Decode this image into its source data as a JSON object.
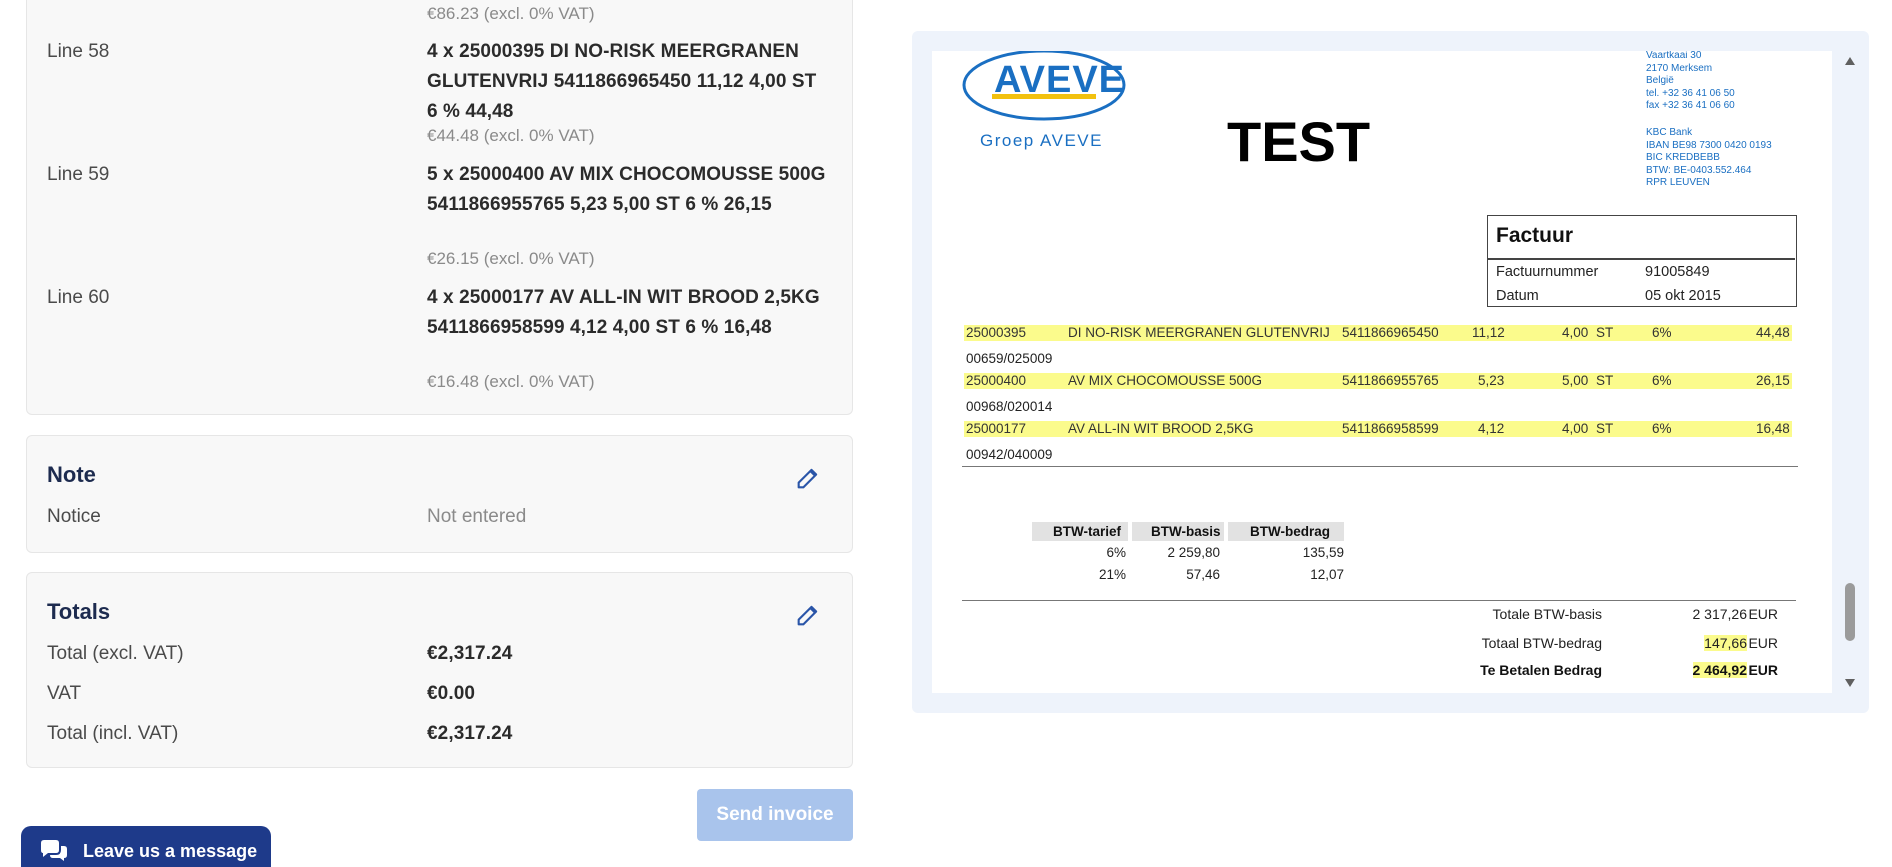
{
  "invoice_lines": [
    {
      "label": "",
      "desc": "",
      "sub": "€86.23 (excl. 0% VAT)"
    },
    {
      "label": "Line 58",
      "desc": "4 x 25000395 DI NO-RISK MEERGRANEN GLUTENVRIJ 5411866965450 11,12 4,00 ST 6 % 44,48",
      "sub": "€44.48 (excl. 0% VAT)"
    },
    {
      "label": "Line 59",
      "desc": "5 x 25000400 AV MIX CHOCOMOUSSE 500G 5411866955765 5,23 5,00 ST 6 % 26,15",
      "sub": "€26.15 (excl. 0% VAT)"
    },
    {
      "label": "Line 60",
      "desc": "4 x 25000177 AV ALL-IN WIT BROOD 2,5KG 5411866958599 4,12 4,00 ST 6 % 16,48",
      "sub": "€16.48 (excl. 0% VAT)"
    }
  ],
  "note": {
    "title": "Note",
    "label": "Notice",
    "value": "Not entered"
  },
  "totals": {
    "title": "Totals",
    "rows": [
      {
        "label": "Total (excl. VAT)",
        "value": "€2,317.24"
      },
      {
        "label": "VAT",
        "value": "€0.00"
      },
      {
        "label": "Total (incl. VAT)",
        "value": "€2,317.24"
      }
    ]
  },
  "send_button": "Send invoice",
  "chat_button": "Leave us a message",
  "document": {
    "logo_text": "AVEVE",
    "logo_sub": "Groep AVEVE",
    "watermark": "TEST",
    "address": [
      "Vaartkaai 30",
      "2170 Merksem",
      "België",
      "tel. +32 36 41 06 50",
      "fax +32 36 41 06 60"
    ],
    "bank": [
      "KBC Bank",
      "IBAN BE98 7300 0420 0193",
      "BIC KREDBEBB",
      "BTW: BE-0403.552.464",
      "RPR LEUVEN"
    ],
    "box_title": "Factuur",
    "invoice_number_label": "Factuurnummer",
    "invoice_number": "91005849",
    "date_label": "Datum",
    "date": "05 okt 2015",
    "rows": [
      {
        "code": "25000395",
        "desc": "DI NO-RISK MEERGRANEN GLUTENVRIJ",
        "ean": "5411866965450",
        "price": "11,12",
        "qty": "4,00",
        "unit": "ST",
        "vat": "6%",
        "total": "44,48",
        "ref": "00659/025009"
      },
      {
        "code": "25000400",
        "desc": "AV MIX CHOCOMOUSSE 500G",
        "ean": "5411866955765",
        "price": "5,23",
        "qty": "5,00",
        "unit": "ST",
        "vat": "6%",
        "total": "26,15",
        "ref": "00968/020014"
      },
      {
        "code": "25000177",
        "desc": "AV ALL-IN WIT BROOD 2,5KG",
        "ean": "5411866958599",
        "price": "4,12",
        "qty": "4,00",
        "unit": "ST",
        "vat": "6%",
        "total": "16,48",
        "ref": "00942/040009"
      }
    ],
    "vat_table": {
      "headers": [
        "BTW-tarief",
        "BTW-basis",
        "BTW-bedrag"
      ],
      "rows": [
        [
          "6%",
          "2 259,80",
          "135,59"
        ],
        [
          "21%",
          "57,46",
          "12,07"
        ]
      ]
    },
    "summary": [
      {
        "label": "Totale BTW-basis",
        "value": "2 317,26",
        "cur": "EUR"
      },
      {
        "label": "Totaal BTW-bedrag",
        "value": "147,66",
        "cur": "EUR"
      },
      {
        "label": "Te Betalen Bedrag",
        "value": "2 464,92",
        "cur": "EUR"
      }
    ]
  },
  "colors": {
    "accent": "#1e3a8a",
    "title": "#1d2b4f",
    "highlight": "#fbfb8c",
    "button_disabled": "#a9c4ec",
    "logo_blue": "#1a6fc2"
  }
}
